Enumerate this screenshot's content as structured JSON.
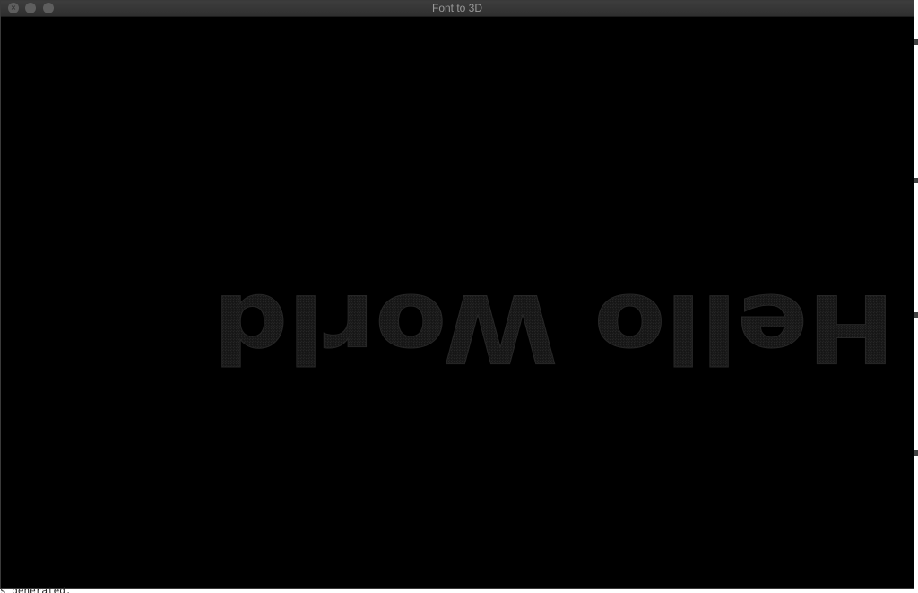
{
  "window": {
    "title": "Font to 3D",
    "controls": {
      "close_icon": "close-icon",
      "minimize_icon": "minimize-icon",
      "zoom_icon": "zoom-icon"
    }
  },
  "scene": {
    "rendered_text": "Hello World",
    "orientation": "upside-down",
    "background_color": "#000000",
    "text_color": "#1c1c1c"
  },
  "terminal_peek": {
    "text": "s generated."
  }
}
